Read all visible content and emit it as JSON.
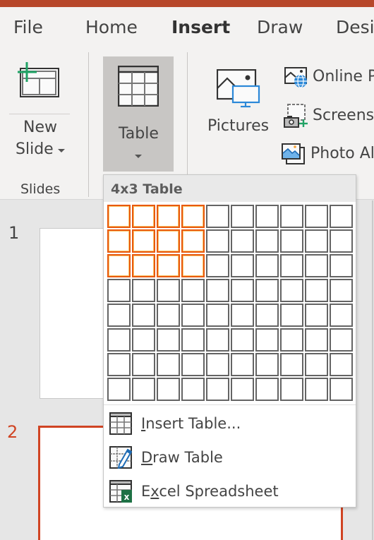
{
  "window": {
    "accent_color": "#b7472a"
  },
  "ribbon_tabs": [
    {
      "label": "File",
      "active": false
    },
    {
      "label": "Home",
      "active": false
    },
    {
      "label": "Insert",
      "active": true
    },
    {
      "label": "Draw",
      "active": false
    },
    {
      "label": "Desi",
      "active": false
    }
  ],
  "ribbon": {
    "new_slide": {
      "line1": "New",
      "line2": "Slide",
      "icon": "new-slide-icon"
    },
    "slides_group_label": "Slides",
    "table": {
      "label": "Table",
      "icon": "table-icon"
    },
    "pictures": {
      "label": "Pictures",
      "icon": "pictures-icon"
    },
    "online_pictures": {
      "label": "Online P",
      "icon": "online-pictures-icon"
    },
    "screenshot": {
      "label": "Screensh",
      "icon": "screenshot-icon"
    },
    "photo_album": {
      "label": "Photo Al",
      "icon": "photo-album-icon"
    }
  },
  "table_dropdown": {
    "title": "4x3 Table",
    "grid": {
      "columns": 10,
      "rows": 8,
      "selected_columns": 4,
      "selected_rows": 3,
      "highlight_color": "#e8590f"
    },
    "menu_items": [
      {
        "prefix": "",
        "accel": "I",
        "rest": "nsert Table...",
        "icon": "insert-table-icon"
      },
      {
        "prefix": "",
        "accel": "D",
        "rest": "raw Table",
        "icon": "draw-table-icon"
      },
      {
        "prefix": "E",
        "accel": "x",
        "rest": "cel Spreadsheet",
        "icon": "excel-spreadsheet-icon"
      }
    ]
  },
  "slides": [
    {
      "number": "1",
      "selected": false
    },
    {
      "number": "2",
      "selected": true
    }
  ]
}
